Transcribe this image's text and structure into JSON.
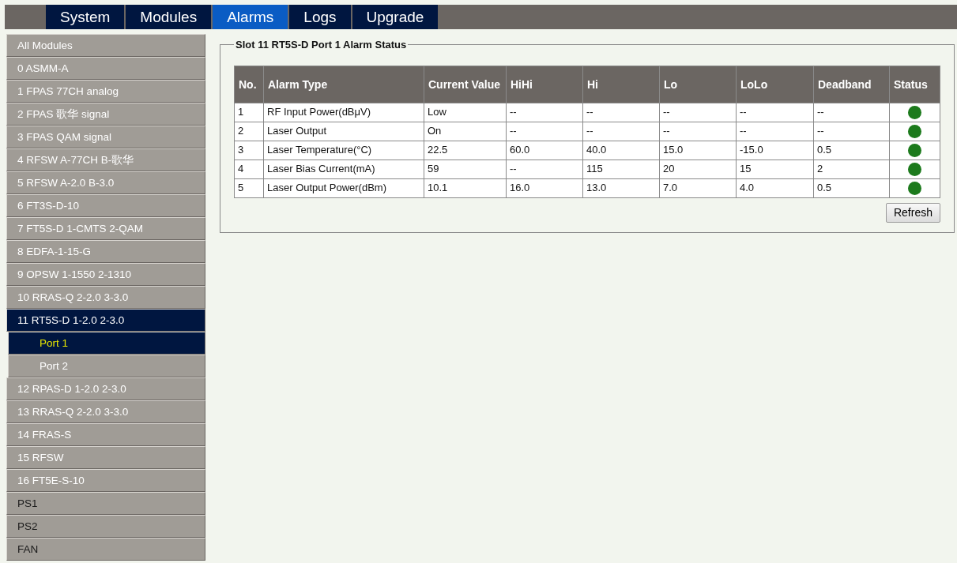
{
  "nav_tabs": [
    {
      "label": "System",
      "selected": false
    },
    {
      "label": "Modules",
      "selected": false
    },
    {
      "label": "Alarms",
      "selected": true
    },
    {
      "label": "Logs",
      "selected": false
    },
    {
      "label": "Upgrade",
      "selected": false
    }
  ],
  "sidebar": {
    "items": [
      {
        "label": "All Modules",
        "kind": "module",
        "selected": false
      },
      {
        "label": "0 ASMM-A",
        "kind": "module",
        "selected": false
      },
      {
        "label": "1 FPAS 77CH analog",
        "kind": "module",
        "selected": false
      },
      {
        "label": "2 FPAS 歌华 signal",
        "kind": "module",
        "selected": false
      },
      {
        "label": "3 FPAS QAM signal",
        "kind": "module",
        "selected": false
      },
      {
        "label": "4 RFSW A-77CH B-歌华",
        "kind": "module",
        "selected": false
      },
      {
        "label": "5 RFSW A-2.0 B-3.0",
        "kind": "module",
        "selected": false
      },
      {
        "label": "6 FT3S-D-10",
        "kind": "module",
        "selected": false
      },
      {
        "label": "7 FT5S-D 1-CMTS 2-QAM",
        "kind": "module",
        "selected": false
      },
      {
        "label": "8 EDFA-1-15-G",
        "kind": "module",
        "selected": false
      },
      {
        "label": "9 OPSW 1-1550 2-1310",
        "kind": "module",
        "selected": false
      },
      {
        "label": "10 RRAS-Q 2-2.0 3-3.0",
        "kind": "module",
        "selected": false
      },
      {
        "label": "11 RT5S-D 1-2.0 2-3.0",
        "kind": "module",
        "selected": true,
        "children": [
          {
            "label": "Port 1",
            "selected": true
          },
          {
            "label": "Port 2",
            "selected": false
          }
        ]
      },
      {
        "label": "12 RPAS-D 1-2.0 2-3.0",
        "kind": "module",
        "selected": false
      },
      {
        "label": "13 RRAS-Q 2-2.0 3-3.0",
        "kind": "module",
        "selected": false
      },
      {
        "label": "14 FRAS-S",
        "kind": "module",
        "selected": false
      },
      {
        "label": "15 RFSW",
        "kind": "module",
        "selected": false
      },
      {
        "label": "16 FT5E-S-10",
        "kind": "module",
        "selected": false
      },
      {
        "label": "PS1",
        "kind": "system",
        "selected": false
      },
      {
        "label": "PS2",
        "kind": "system",
        "selected": false
      },
      {
        "label": "FAN",
        "kind": "system",
        "selected": false
      }
    ]
  },
  "panel": {
    "title": "Slot 11 RT5S-D Port 1 Alarm Status",
    "table": {
      "columns": [
        "No.",
        "Alarm Type",
        "Current Value",
        "HiHi",
        "Hi",
        "Lo",
        "LoLo",
        "Deadband",
        "Status"
      ],
      "rows": [
        {
          "cells": [
            "1",
            "RF Input Power(dBμV)",
            "Low",
            "--",
            "--",
            "--",
            "--",
            "--"
          ],
          "color": "#1c7a1c"
        },
        {
          "cells": [
            "2",
            "Laser Output",
            "On",
            "--",
            "--",
            "--",
            "--",
            "--"
          ],
          "color": "#1c7a1c"
        },
        {
          "cells": [
            "3",
            "Laser Temperature(°C)",
            "22.5",
            "60.0",
            "40.0",
            "15.0",
            "-15.0",
            "0.5"
          ],
          "color": "#1c7a1c"
        },
        {
          "cells": [
            "4",
            "Laser Bias Current(mA)",
            "59",
            "--",
            "115",
            "20",
            "15",
            "2"
          ],
          "color": "#1c7a1c"
        },
        {
          "cells": [
            "5",
            "Laser Output Power(dBm)",
            "10.1",
            "16.0",
            "13.0",
            "7.0",
            "4.0",
            "0.5"
          ],
          "color": "#1c7a1c"
        }
      ]
    },
    "button": "Refresh"
  }
}
